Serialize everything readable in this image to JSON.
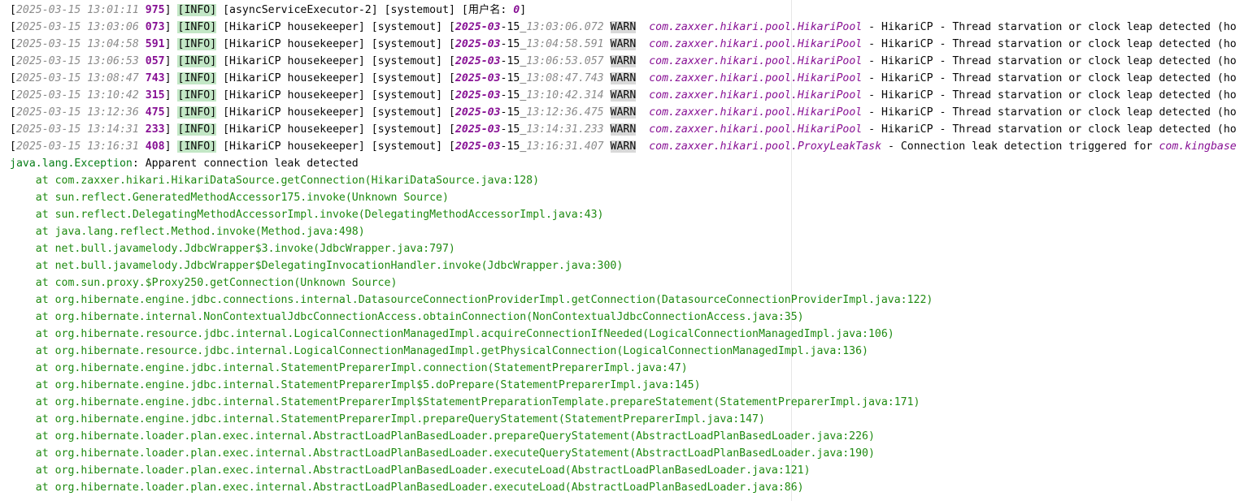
{
  "log_lines": [
    {
      "ts": "2025-03-15 13:01:11",
      "ms": "975",
      "level": "INFO",
      "thread": "asyncServiceExecutor-2",
      "src": "systemout",
      "user_label": "用户名: ",
      "user_value": "0"
    },
    {
      "ts": "2025-03-15 13:03:06",
      "ms": "073",
      "level": "INFO",
      "thread": "HikariCP housekeeper",
      "src": "systemout",
      "d_ym": "2025-03",
      "d_day": "-15_",
      "d_time": "13:03:06.072",
      "wlevel": "WARN",
      "logger": "com.zaxxer.hikari.pool.HikariPool",
      "msg": " - HikariCP - Thread starvation or clock leap detected (ho"
    },
    {
      "ts": "2025-03-15 13:04:58",
      "ms": "591",
      "level": "INFO",
      "thread": "HikariCP housekeeper",
      "src": "systemout",
      "d_ym": "2025-03",
      "d_day": "-15_",
      "d_time": "13:04:58.591",
      "wlevel": "WARN",
      "logger": "com.zaxxer.hikari.pool.HikariPool",
      "msg": " - HikariCP - Thread starvation or clock leap detected (ho"
    },
    {
      "ts": "2025-03-15 13:06:53",
      "ms": "057",
      "level": "INFO",
      "thread": "HikariCP housekeeper",
      "src": "systemout",
      "d_ym": "2025-03",
      "d_day": "-15_",
      "d_time": "13:06:53.057",
      "wlevel": "WARN",
      "logger": "com.zaxxer.hikari.pool.HikariPool",
      "msg": " - HikariCP - Thread starvation or clock leap detected (ho"
    },
    {
      "ts": "2025-03-15 13:08:47",
      "ms": "743",
      "level": "INFO",
      "thread": "HikariCP housekeeper",
      "src": "systemout",
      "d_ym": "2025-03",
      "d_day": "-15_",
      "d_time": "13:08:47.743",
      "wlevel": "WARN",
      "logger": "com.zaxxer.hikari.pool.HikariPool",
      "msg": " - HikariCP - Thread starvation or clock leap detected (ho"
    },
    {
      "ts": "2025-03-15 13:10:42",
      "ms": "315",
      "level": "INFO",
      "thread": "HikariCP housekeeper",
      "src": "systemout",
      "d_ym": "2025-03",
      "d_day": "-15_",
      "d_time": "13:10:42.314",
      "wlevel": "WARN",
      "logger": "com.zaxxer.hikari.pool.HikariPool",
      "msg": " - HikariCP - Thread starvation or clock leap detected (ho"
    },
    {
      "ts": "2025-03-15 13:12:36",
      "ms": "475",
      "level": "INFO",
      "thread": "HikariCP housekeeper",
      "src": "systemout",
      "d_ym": "2025-03",
      "d_day": "-15_",
      "d_time": "13:12:36.475",
      "wlevel": "WARN",
      "logger": "com.zaxxer.hikari.pool.HikariPool",
      "msg": " - HikariCP - Thread starvation or clock leap detected (ho"
    },
    {
      "ts": "2025-03-15 13:14:31",
      "ms": "233",
      "level": "INFO",
      "thread": "HikariCP housekeeper",
      "src": "systemout",
      "d_ym": "2025-03",
      "d_day": "-15_",
      "d_time": "13:14:31.233",
      "wlevel": "WARN",
      "logger": "com.zaxxer.hikari.pool.HikariPool",
      "msg": " - HikariCP - Thread starvation or clock leap detected (ho"
    },
    {
      "ts": "2025-03-15 13:16:31",
      "ms": "408",
      "level": "INFO",
      "thread": "HikariCP housekeeper",
      "src": "systemout",
      "d_ym": "2025-03",
      "d_day": "-15_",
      "d_time": "13:16:31.407",
      "wlevel": "WARN",
      "logger": "com.zaxxer.hikari.pool.ProxyLeakTask",
      "msg": " - Connection leak detection triggered for ",
      "msg_tail": "com.kingbase"
    }
  ],
  "exception": {
    "class": "java.lang.Exception",
    "message": ": Apparent connection leak detected"
  },
  "stack": [
    "at com.zaxxer.hikari.HikariDataSource.getConnection(HikariDataSource.java:128)",
    "at sun.reflect.GeneratedMethodAccessor175.invoke(Unknown Source)",
    "at sun.reflect.DelegatingMethodAccessorImpl.invoke(DelegatingMethodAccessorImpl.java:43)",
    "at java.lang.reflect.Method.invoke(Method.java:498)",
    "at net.bull.javamelody.JdbcWrapper$3.invoke(JdbcWrapper.java:797)",
    "at net.bull.javamelody.JdbcWrapper$DelegatingInvocationHandler.invoke(JdbcWrapper.java:300)",
    "at com.sun.proxy.$Proxy250.getConnection(Unknown Source)",
    "at org.hibernate.engine.jdbc.connections.internal.DatasourceConnectionProviderImpl.getConnection(DatasourceConnectionProviderImpl.java:122)",
    "at org.hibernate.internal.NonContextualJdbcConnectionAccess.obtainConnection(NonContextualJdbcConnectionAccess.java:35)",
    "at org.hibernate.resource.jdbc.internal.LogicalConnectionManagedImpl.acquireConnectionIfNeeded(LogicalConnectionManagedImpl.java:106)",
    "at org.hibernate.resource.jdbc.internal.LogicalConnectionManagedImpl.getPhysicalConnection(LogicalConnectionManagedImpl.java:136)",
    "at org.hibernate.engine.jdbc.internal.StatementPreparerImpl.connection(StatementPreparerImpl.java:47)",
    "at org.hibernate.engine.jdbc.internal.StatementPreparerImpl$5.doPrepare(StatementPreparerImpl.java:145)",
    "at org.hibernate.engine.jdbc.internal.StatementPreparerImpl$StatementPreparationTemplate.prepareStatement(StatementPreparerImpl.java:171)",
    "at org.hibernate.engine.jdbc.internal.StatementPreparerImpl.prepareQueryStatement(StatementPreparerImpl.java:147)",
    "at org.hibernate.loader.plan.exec.internal.AbstractLoadPlanBasedLoader.prepareQueryStatement(AbstractLoadPlanBasedLoader.java:226)",
    "at org.hibernate.loader.plan.exec.internal.AbstractLoadPlanBasedLoader.executeQueryStatement(AbstractLoadPlanBasedLoader.java:190)",
    "at org.hibernate.loader.plan.exec.internal.AbstractLoadPlanBasedLoader.executeLoad(AbstractLoadPlanBasedLoader.java:121)",
    "at org.hibernate.loader.plan.exec.internal.AbstractLoadPlanBasedLoader.executeLoad(AbstractLoadPlanBasedLoader.java:86)"
  ]
}
